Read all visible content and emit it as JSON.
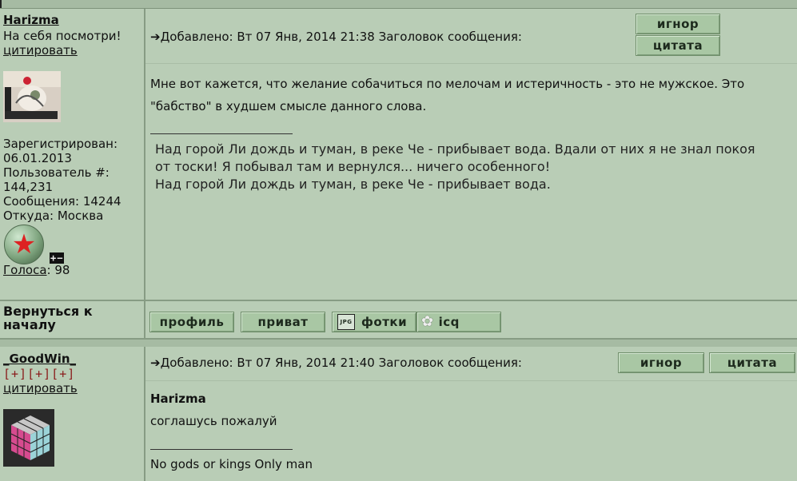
{
  "post1": {
    "username": "Harizma",
    "rank": "На себя посмотри!",
    "quote_link": "цитировать",
    "registered_label": "Зарегистрирован:",
    "registered_date": "06.01.2013",
    "user_no_label": "Пользователь #:",
    "user_no": "144,231",
    "messages": "Сообщения: 14244",
    "location": "Откуда: Москва",
    "pm_toggle": "+−",
    "votes_label": "Голоса",
    "votes_value": ": 98",
    "posted_arrow": "➔",
    "posted_text": "Добавлено: Вт 07 Янв, 2014 21:38 Заголовок сообщения:",
    "ignore_btn": "игнор",
    "quote_btn": "цитата",
    "body_line1": "Мне вот кажется, что желание собачиться по мелочам и истеричность - это не мужское. Это",
    "body_line2": "\"бабство\" в худшем смысле данного слова.",
    "signature_lines": [
      "Над горой Ли дождь и туман, в реке Че - прибывает вода. Вдали от них я не знал покоя",
      "от тоски! Я побывал там и вернулся... ничего особенного!",
      "Над горой Ли дождь и туман, в реке Че - прибывает вода."
    ]
  },
  "back_row": {
    "label_line1": "Вернуться к",
    "label_line2": "началу",
    "buttons": [
      "профиль",
      "приват",
      "фотки",
      "icq"
    ],
    "photo_icon_text": "JPG"
  },
  "post2": {
    "username": "_GoodWin_",
    "plus_marks": "[+][+][+]",
    "quote_link": "цитировать",
    "posted_arrow": "➔",
    "posted_text": "Добавлено: Вт 07 Янв, 2014 21:40 Заголовок сообщения:",
    "ignore_btn": "игнор",
    "quote_btn": "цитата",
    "quoted_author": "Harizma",
    "body": "соглашусь пожалуй",
    "signature": "No gods or kings Only man"
  },
  "colors": {
    "background": "#a6bba3",
    "panel": "#b9cdb6",
    "button": "#a9c7a4",
    "badge_star": "#d22222"
  }
}
